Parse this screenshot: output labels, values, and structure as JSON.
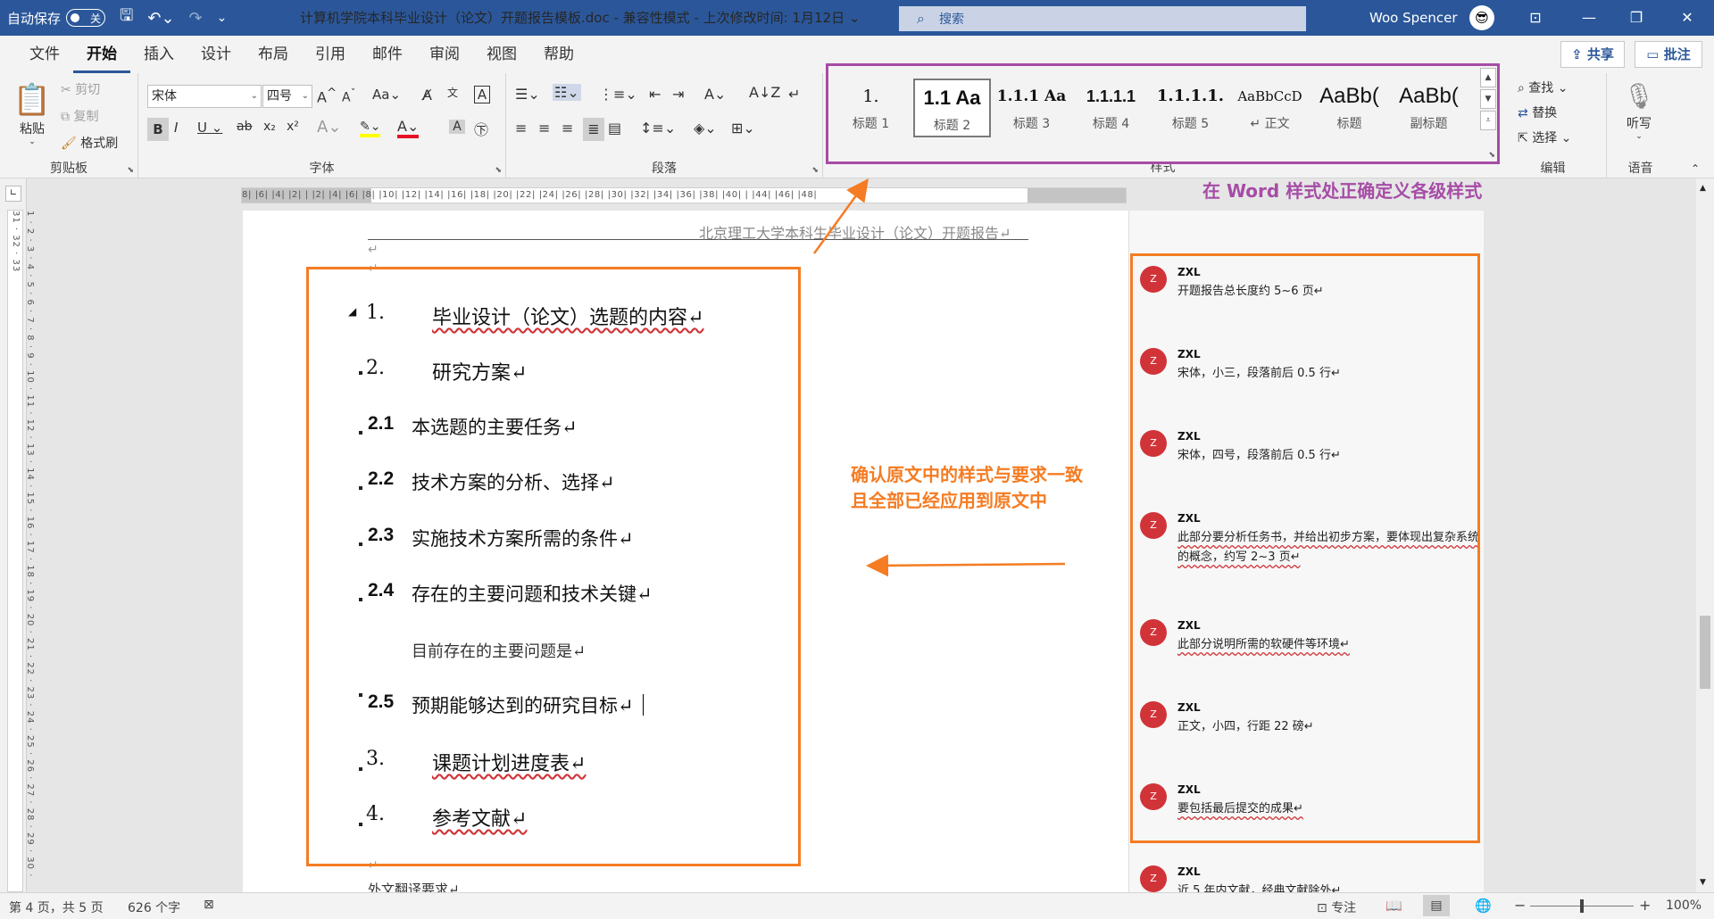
{
  "titlebar": {
    "autosave_label": "自动保存",
    "autosave_state": "关",
    "doc_title": "计算机学院本科毕业设计（论文）开题报告模板.doc  -  兼容性模式  -  上次修改时间: 1月12日 ⌄",
    "search_placeholder": "搜索",
    "user_name": "Woo Spencer",
    "avatar_glyph": "😎"
  },
  "tabs": [
    "文件",
    "开始",
    "插入",
    "设计",
    "布局",
    "引用",
    "邮件",
    "审阅",
    "视图",
    "帮助"
  ],
  "share_label": "共享",
  "comment_label": "批注",
  "clipboard": {
    "paste": "粘贴",
    "cut": "剪切",
    "copy": "复制",
    "format_painter": "格式刷",
    "group": "剪贴板"
  },
  "font": {
    "name": "宋体",
    "size": "四号",
    "group": "字体"
  },
  "paragraph": {
    "group": "段落"
  },
  "styles": {
    "group": "样式",
    "items": [
      {
        "preview": "1.",
        "name": "标题 1"
      },
      {
        "preview": "1.1 Aa",
        "name": "标题 2"
      },
      {
        "preview": "1.1.1 Aa",
        "name": "标题 3"
      },
      {
        "preview": "1.1.1.1",
        "name": "标题 4"
      },
      {
        "preview": "1.1.1.1.",
        "name": "标题 5"
      },
      {
        "preview": "AaBbCcD",
        "name": "↵ 正文"
      },
      {
        "preview": "AaBb(",
        "name": "标题"
      },
      {
        "preview": "AaBb(",
        "name": "副标题"
      }
    ]
  },
  "editing": {
    "find": "查找",
    "replace": "替换",
    "select": "选择",
    "group": "编辑"
  },
  "voice": {
    "dictate": "听写",
    "group": "语音"
  },
  "ruler": {
    "h_text": "8| |6| |4| |2| | |2| |4| |6| |8| |10| |12| |14| |16| |18| |20| |22| |24| |26| |28| |30| |32| |34| |36| |38| |40| | |44| |46| |48|",
    "v_text": "1 · 2 · 3 · 4 · 5 · 6 · 7 · 8 · 9 · 10 · 11 · 12 · 13 · 14 · 15 · 16 · 17 · 18 · 19 · 20 · 21 · 22 · 23 · 24 · 25 · 26 · 27 · 28 · 29 · 30 · 31 · 32 · 33"
  },
  "document": {
    "header": "北京理工大学本科生毕业设计（论文）开题报告↵",
    "headings": [
      {
        "num": "1.",
        "text": "毕业设计（论文）选题的内容↵"
      },
      {
        "num": "2.",
        "text": "研究方案↵"
      },
      {
        "num": "2.1",
        "text": "本选题的主要任务↵"
      },
      {
        "num": "2.2",
        "text": "技术方案的分析、选择↵"
      },
      {
        "num": "2.3",
        "text": "实施技术方案所需的条件↵"
      },
      {
        "num": "2.4",
        "text": "存在的主要问题和技术关键↵"
      },
      {
        "num": "2.5",
        "text": "预期能够达到的研究目标↵"
      },
      {
        "num": "3.",
        "text": "课题计划进度表↵"
      },
      {
        "num": "4.",
        "text": "参考文献↵"
      }
    ],
    "body_para": "目前存在的主要问题是↵",
    "footer_text": "外文翻译要求↵",
    "para_mark": "↵"
  },
  "comments": [
    {
      "initial": "Z",
      "author": "ZXL",
      "text": "开题报告总长度约 5~6 页↵"
    },
    {
      "initial": "Z",
      "author": "ZXL",
      "text": "宋体，小三，段落前后 0.5 行↵"
    },
    {
      "initial": "Z",
      "author": "ZXL",
      "text": "宋体，四号，段落前后 0.5 行↵"
    },
    {
      "initial": "Z",
      "author": "ZXL",
      "text": "此部分要分析任务书，并给出初步方案，要体现出复杂系统的概念，约写 2~3 页↵"
    },
    {
      "initial": "Z",
      "author": "ZXL",
      "text": "此部分说明所需的软硬件等环境↵"
    },
    {
      "initial": "Z",
      "author": "ZXL",
      "text": "正文，小四，行距 22 磅↵"
    },
    {
      "initial": "Z",
      "author": "ZXL",
      "text": "要包括最后提交的成果↵"
    },
    {
      "initial": "Z",
      "author": "ZXL",
      "text": "近 5 年内文献，经典文献除外↵"
    }
  ],
  "annotations": {
    "styles_note": "在 Word 样式处正确定义各级样式",
    "confirm_line1": "确认原文中的样式与要求一致",
    "confirm_line2": "且全部已经应用到原文中"
  },
  "statusbar": {
    "page": "第 4 页，共 5 页",
    "words": "626 个字",
    "focus": "专注",
    "zoom": "100%"
  },
  "colors": {
    "brand": "#2b579a",
    "annotation_orange": "#f57c23",
    "annotation_purple": "#a64ca6",
    "comment_red": "#d13438"
  }
}
